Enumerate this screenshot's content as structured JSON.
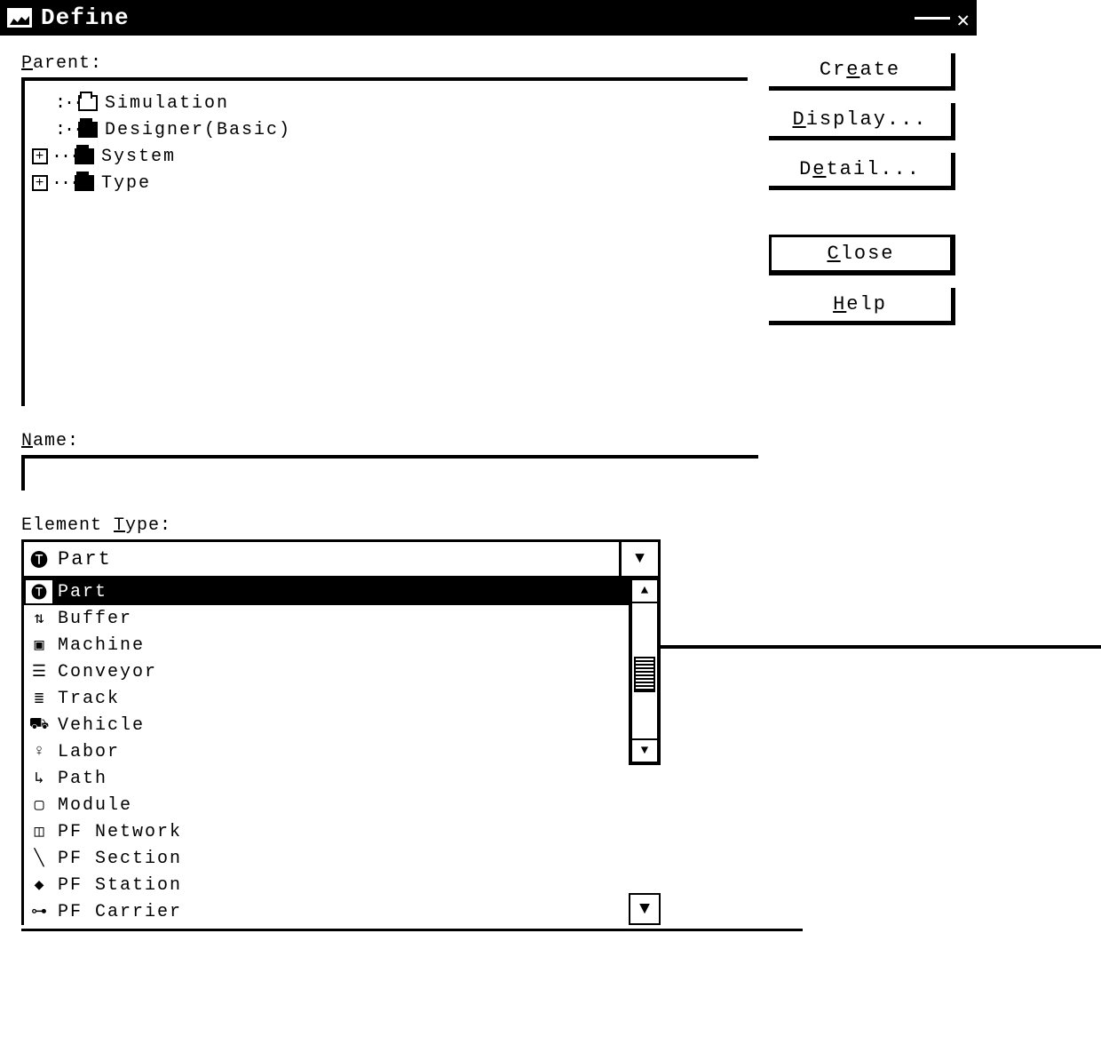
{
  "window": {
    "title": "Define"
  },
  "labels": {
    "parent_pre": "P",
    "parent_post": "arent:",
    "name_pre": "N",
    "name_post": "ame:",
    "eltype_pre": "Element ",
    "eltype_accel": "T",
    "eltype_post": "ype:"
  },
  "tree": {
    "items": [
      {
        "label": "Simulation",
        "icon": "open",
        "expandable": false,
        "depth": 1
      },
      {
        "label": "Designer(Basic)",
        "icon": "closed",
        "expandable": false,
        "depth": 1
      },
      {
        "label": "System",
        "icon": "closed",
        "expandable": true,
        "depth": 0
      },
      {
        "label": "Type",
        "icon": "closed",
        "expandable": true,
        "depth": 0
      }
    ]
  },
  "buttons": {
    "create": {
      "pre": "Cr",
      "accel": "e",
      "post": "ate"
    },
    "display": {
      "pre": "",
      "accel": "D",
      "post": "isplay..."
    },
    "detail": {
      "pre": "D",
      "accel": "e",
      "post": "tail..."
    },
    "close": {
      "pre": "",
      "accel": "C",
      "post": "lose"
    },
    "help": {
      "pre": "",
      "accel": "H",
      "post": "elp"
    }
  },
  "name_field": {
    "value": ""
  },
  "element_type": {
    "selected": "Part",
    "options": [
      {
        "label": "Part",
        "icon": "part-icon",
        "glyph": "🅣"
      },
      {
        "label": "Buffer",
        "icon": "buffer-icon",
        "glyph": "⇅"
      },
      {
        "label": "Machine",
        "icon": "machine-icon",
        "glyph": "▣"
      },
      {
        "label": "Conveyor",
        "icon": "conveyor-icon",
        "glyph": "☰"
      },
      {
        "label": "Track",
        "icon": "track-icon",
        "glyph": "≣"
      },
      {
        "label": "Vehicle",
        "icon": "vehicle-icon",
        "glyph": "⛟"
      },
      {
        "label": "Labor",
        "icon": "labor-icon",
        "glyph": "♀"
      },
      {
        "label": "Path",
        "icon": "path-icon",
        "glyph": "↳"
      },
      {
        "label": "Module",
        "icon": "module-icon",
        "glyph": "▢"
      },
      {
        "label": "PF Network",
        "icon": "pfnet-icon",
        "glyph": "◫"
      },
      {
        "label": "PF Section",
        "icon": "pfsec-icon",
        "glyph": "╲"
      },
      {
        "label": "PF Station",
        "icon": "pfsta-icon",
        "glyph": "◆"
      },
      {
        "label": "PF Carrier",
        "icon": "pfcar-icon",
        "glyph": "⊶"
      }
    ]
  }
}
